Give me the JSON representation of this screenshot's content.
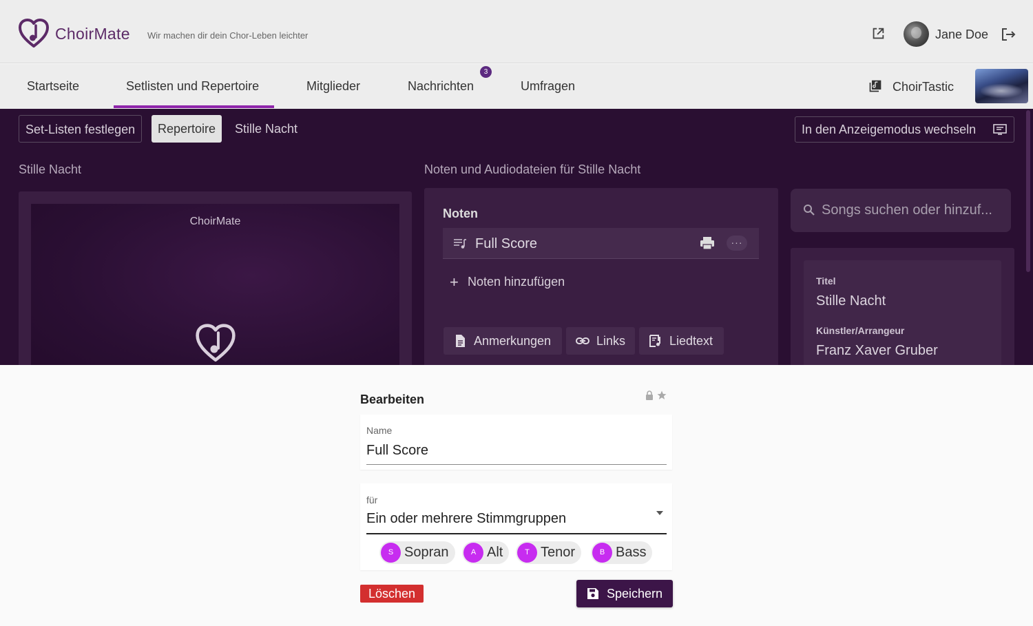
{
  "header": {
    "brand": "ChoirMate",
    "tagline": "Wir machen dir dein Chor-Leben leichter",
    "username": "Jane Doe"
  },
  "nav": {
    "items": [
      {
        "label": "Startseite"
      },
      {
        "label": "Setlisten und Repertoire"
      },
      {
        "label": "Mitglieder"
      },
      {
        "label": "Nachrichten"
      },
      {
        "label": "Umfragen"
      }
    ],
    "active_index": 1,
    "messages_badge": "3",
    "choir_name": "ChoirTastic"
  },
  "subtabs": {
    "items": [
      {
        "label": "Set-Listen festlegen"
      },
      {
        "label": "Repertoire"
      },
      {
        "label": "Stille Nacht"
      }
    ],
    "mode_button": "In den Anzeigemodus wechseln"
  },
  "left_panel": {
    "title": "Stille Nacht",
    "preview_title": "ChoirMate"
  },
  "middle_panel": {
    "title": "Noten und Audiodateien für Stille Nacht",
    "noten_heading": "Noten",
    "score_item": "Full Score",
    "more_label": "···",
    "add_noten": "Noten hinzufügen",
    "tools": {
      "notes": "Anmerkungen",
      "links": "Links",
      "lyrics": "Liedtext"
    }
  },
  "search": {
    "placeholder": "Songs suchen oder hinzuf..."
  },
  "song_info": {
    "title_label": "Titel",
    "title_value": "Stille Nacht",
    "artist_label": "Künstler/Arrangeur",
    "artist_value": "Franz Xaver Gruber"
  },
  "edit": {
    "heading": "Bearbeiten",
    "name_label": "Name",
    "name_value": "Full Score",
    "for_label": "für",
    "for_value": "Ein oder mehrere Stimmgruppen",
    "voices": [
      {
        "initial": "S",
        "label": "Sopran"
      },
      {
        "initial": "A",
        "label": "Alt"
      },
      {
        "initial": "T",
        "label": "Tenor"
      },
      {
        "initial": "B",
        "label": "Bass"
      }
    ],
    "delete_label": "Löschen",
    "save_label": "Speichern"
  },
  "colors": {
    "brand_purple": "#5c2a67",
    "accent_purple": "#8e24aa",
    "dark_bg": "#2a0f32",
    "chip_avatar": "#c72cf0",
    "delete_red": "#d32f2f",
    "save_bg": "#3c1548"
  },
  "icons": {
    "logo": "heart-note-logo",
    "external": "external-link-icon",
    "logout": "logout-icon",
    "choir": "library-icon",
    "display": "display-mode-icon",
    "score": "sheet-music-icon",
    "print": "printer-icon",
    "search": "search-icon",
    "lock": "lock-icon",
    "star": "star-icon",
    "save": "floppy-disk-icon"
  }
}
